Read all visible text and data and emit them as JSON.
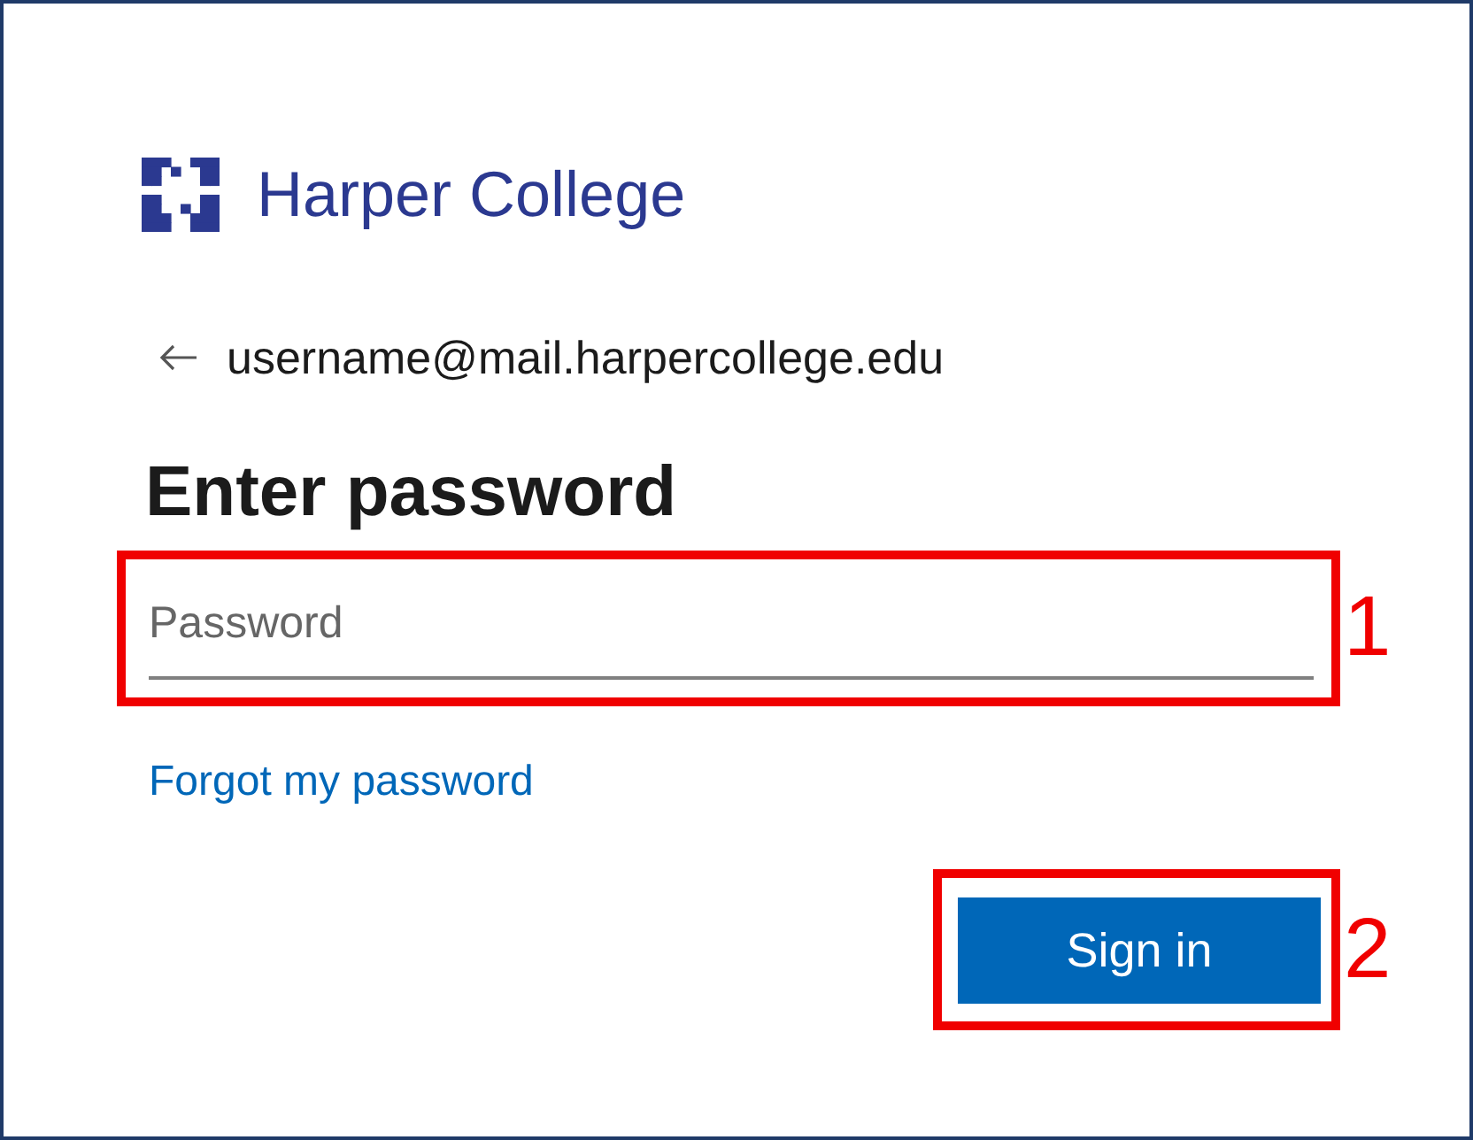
{
  "logo": {
    "name": "Harper College"
  },
  "account": {
    "email": "username@mail.harpercollege.edu"
  },
  "heading": "Enter password",
  "password_field": {
    "placeholder": "Password"
  },
  "forgot_link": "Forgot my password",
  "sign_in_button": {
    "label": "Sign in"
  },
  "annotations": [
    {
      "label": "1"
    },
    {
      "label": "2"
    }
  ]
}
